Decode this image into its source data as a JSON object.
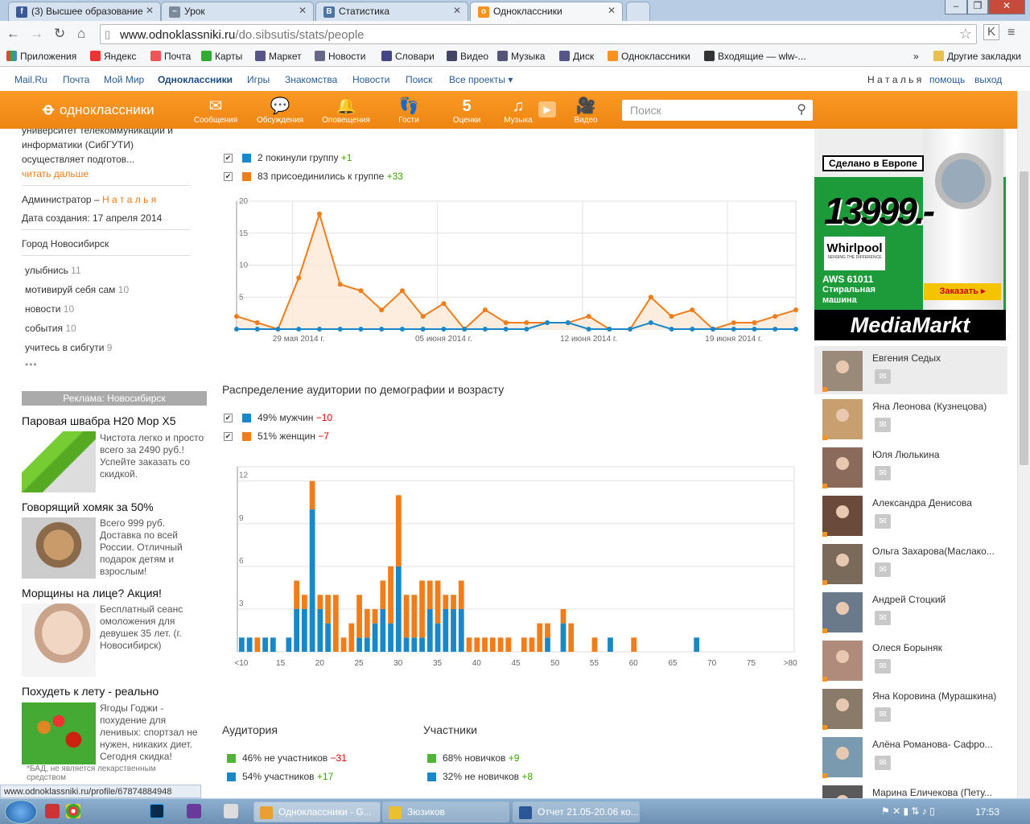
{
  "browser": {
    "tabs": [
      {
        "title": "(3) Высшее образование",
        "icon": "facebook-icon",
        "color": "#3b5998",
        "glyph": "f"
      },
      {
        "title": "Урок",
        "icon": "page-icon",
        "color": "#7a8a9a",
        "glyph": "~"
      },
      {
        "title": "Статистика",
        "icon": "vk-icon",
        "color": "#4c75a3",
        "glyph": "B"
      },
      {
        "title": "Одноклассники",
        "icon": "odnoklassniki-icon",
        "color": "#f7931e",
        "glyph": "o"
      }
    ],
    "url_host": "www.odnoklassniki.ru",
    "url_path": "/do.sibsutis/stats/people",
    "bookmarks": [
      {
        "label": "Приложения",
        "color": "#d44"
      },
      {
        "label": "Яндекс",
        "color": "#e33"
      },
      {
        "label": "Почта",
        "color": "#e55"
      },
      {
        "label": "Карты",
        "color": "#3a3"
      },
      {
        "label": "Маркет",
        "color": "#558"
      },
      {
        "label": "Новости",
        "color": "#668"
      },
      {
        "label": "Словари",
        "color": "#448"
      },
      {
        "label": "Видео",
        "color": "#446"
      },
      {
        "label": "Музыка",
        "color": "#557"
      },
      {
        "label": "Диск",
        "color": "#558"
      },
      {
        "label": "Одноклассники",
        "color": "#f7931e"
      },
      {
        "label": "Входящие — wlw-...",
        "color": "#333"
      }
    ],
    "more": "»",
    "other_bookmarks": "Другие закладки",
    "status_url": "www.odnoklassniki.ru/profile/67874884948"
  },
  "portal": {
    "links": [
      "Mail.Ru",
      "Почта",
      "Мой Мир",
      "Одноклассники",
      "Игры",
      "Знакомства",
      "Новости",
      "Поиск",
      "Все проекты ▾"
    ],
    "user": "Н а т а л ь я",
    "help": "помощь",
    "logout": "выход"
  },
  "ok": {
    "logo": "одноклассники",
    "nav": [
      {
        "label": "Сообщения",
        "icon": "envelope-icon",
        "glyph": "✉"
      },
      {
        "label": "Обсуждения",
        "icon": "chat-icon",
        "glyph": "💬"
      },
      {
        "label": "Оповещения",
        "icon": "bell-icon",
        "glyph": "🔔"
      },
      {
        "label": "Гости",
        "icon": "footprints-icon",
        "glyph": "👣"
      },
      {
        "label": "Оценки",
        "icon": "rating-icon",
        "glyph": "5"
      },
      {
        "label": "Музыка",
        "icon": "music-icon",
        "glyph": "♫"
      },
      {
        "label": "Видео",
        "icon": "camera-icon",
        "glyph": "🎥"
      }
    ],
    "search_placeholder": "Поиск"
  },
  "group": {
    "desc1": "университет телекоммуникаций и",
    "desc2": "информатики (СибГУТИ)",
    "desc3": "осуществляет подготов...",
    "read_more": "читать дальше",
    "admin_label": "Администратор –",
    "admin_name": "Н а т а л ь я",
    "created": "Дата создания: 17 апреля 2014",
    "city": "Город Новосибирск",
    "topics": [
      {
        "name": "улыбнись",
        "count": "11"
      },
      {
        "name": "мотивируй себя сам",
        "count": "10"
      },
      {
        "name": "новости",
        "count": "10"
      },
      {
        "name": "события",
        "count": "10"
      },
      {
        "name": "учитесь в сибгути",
        "count": "9"
      }
    ],
    "more": "•••"
  },
  "ads": {
    "header": "Реклама: Новосибирск",
    "items": [
      {
        "title": "Паровая швабра H20 Mop X5",
        "text": "Чистота легко и просто всего за 2490 руб.! Успейте заказать со скидкой."
      },
      {
        "title": "Говорящий хомяк за 50%",
        "text": "Всего 999 руб. Доставка по всей России. Отличный подарок детям и взрослым!"
      },
      {
        "title": "Морщины на лице? Акция!",
        "text": "Бесплатный сеанс омоложения для девушек 35 лет. (г. Новосибирск)"
      },
      {
        "title": "Похудеть к лету - реально",
        "text": "Ягоды Годжи - похудение для ленивых: спортзал не нужен, никаких диет. Сегодня скидка!"
      }
    ],
    "disclaimer": "*БАД, не является лекарственным средством"
  },
  "stats": {
    "left_legend": [
      {
        "text": "2 покинули группу",
        "delta": "+1",
        "color": "#1a88c8"
      },
      {
        "text": "83 присоединились к группе",
        "delta": "+33",
        "color": "#f07c1a"
      }
    ],
    "demo_title": "Распределение аудитории по демографии и возрасту",
    "demo_legend": [
      {
        "text": "49% мужчин",
        "delta": "−10",
        "color": "#1a88c8"
      },
      {
        "text": "51% женщин",
        "delta": "−7",
        "color": "#f07c1a"
      }
    ],
    "audience_title": "Аудитория",
    "audience": [
      {
        "text": "46% не участников",
        "delta": "−31",
        "color": "#4fb535"
      },
      {
        "text": "54% участников",
        "delta": "+17",
        "color": "#1a88c8"
      }
    ],
    "members_title": "Участники",
    "members": [
      {
        "text": "68% новичков",
        "delta": "+9",
        "color": "#4fb535"
      },
      {
        "text": "32% не новичков",
        "delta": "+8",
        "color": "#1a88c8"
      }
    ]
  },
  "chart_data": [
    {
      "type": "line",
      "x_tick_labels": [
        "29 мая 2014 г.",
        "05 июня 2014 г.",
        "12 июня 2014 г.",
        "19 июня 2014 г."
      ],
      "ylim": [
        0,
        20
      ],
      "yticks": [
        5,
        10,
        15,
        20
      ],
      "series": [
        {
          "name": "присоединились к группе",
          "color": "#f07c1a",
          "values": [
            2,
            1,
            0,
            8,
            18,
            7,
            6,
            3,
            6,
            2,
            4,
            0,
            3,
            1,
            1,
            1,
            1,
            2,
            0,
            0,
            5,
            2,
            3,
            0,
            1,
            1,
            2,
            3
          ]
        },
        {
          "name": "покинули группу",
          "color": "#1a88c8",
          "values": [
            0,
            0,
            0,
            0,
            0,
            0,
            0,
            0,
            0,
            0,
            0,
            0,
            0,
            0,
            0,
            1,
            1,
            0,
            0,
            0,
            1,
            0,
            0,
            0,
            0,
            0,
            0,
            0
          ]
        }
      ]
    },
    {
      "type": "bar",
      "x_tick_labels": [
        "<10",
        "15",
        "20",
        "25",
        "30",
        "35",
        "40",
        "45",
        "50",
        "55",
        "60",
        "65",
        "70",
        "75",
        ">80"
      ],
      "ylim": [
        0,
        13
      ],
      "yticks": [
        3,
        6,
        9,
        12
      ],
      "categories": [
        "<10",
        "11",
        "12",
        "13",
        "14",
        "15",
        "16",
        "17",
        "18",
        "19",
        "20",
        "21",
        "22",
        "23",
        "24",
        "25",
        "26",
        "27",
        "28",
        "29",
        "30",
        "31",
        "32",
        "33",
        "34",
        "35",
        "36",
        "37",
        "38",
        "39",
        "40",
        "41",
        "42",
        "43",
        "44",
        "45",
        "46",
        "47",
        "48",
        "49",
        "50",
        "51",
        "52",
        "53",
        "54",
        "55",
        "56",
        "57",
        "58",
        "59",
        "60",
        "61",
        "62",
        "63",
        "64",
        "65",
        "66",
        "67",
        "68",
        "69",
        "70",
        "71",
        "72",
        "73",
        "74",
        "75",
        "76",
        "77",
        "78",
        "79",
        ">80"
      ],
      "series": [
        {
          "name": "мужчины",
          "color": "#1a88c8",
          "values": [
            1,
            1,
            0,
            1,
            1,
            0,
            1,
            3,
            3,
            10,
            3,
            2,
            0,
            0,
            0,
            1,
            1,
            2,
            3,
            2,
            6,
            1,
            1,
            1,
            3,
            2,
            3,
            3,
            3,
            0,
            0,
            0,
            0,
            0,
            0,
            0,
            0,
            0,
            0,
            1,
            0,
            2,
            0,
            0,
            0,
            0,
            0,
            1,
            0,
            0,
            0,
            0,
            0,
            0,
            0,
            0,
            0,
            0,
            1,
            0,
            0,
            0,
            0,
            0,
            0,
            0,
            0,
            0,
            0,
            0,
            0
          ]
        },
        {
          "name": "женщины",
          "color": "#f07c1a",
          "values": [
            0,
            0,
            1,
            0,
            0,
            0,
            0,
            2,
            1,
            2,
            1,
            2,
            4,
            1,
            2,
            3,
            2,
            1,
            2,
            4,
            5,
            3,
            3,
            4,
            2,
            3,
            1,
            1,
            2,
            1,
            1,
            1,
            1,
            1,
            1,
            0,
            1,
            1,
            2,
            1,
            0,
            1,
            2,
            0,
            0,
            1,
            0,
            0,
            0,
            0,
            1,
            0,
            0,
            0,
            0,
            0,
            0,
            0,
            0,
            0,
            0,
            0,
            0,
            0,
            0,
            0,
            0,
            0,
            0,
            0,
            0
          ]
        }
      ]
    }
  ],
  "banner": {
    "tag": "Сделано в Европе",
    "price": "13999.-",
    "brand": "Whirlpool",
    "brand_sub": "SENSING THE DIFFERENCE",
    "model": "AWS 61011",
    "desc1": "Стиральная",
    "desc2": "машина",
    "order": "Заказать ▸",
    "store": "MediaMarkt"
  },
  "friends": [
    "Евгения Седых",
    "Яна Леонова (Кузнецова)",
    "Юля Люлькина",
    "Александра Денисова",
    "Ольга Захарова(Маслако...",
    "Андрей Стоцкий",
    "Олеся Борыняк",
    "Яна Коровина (Мурашкина)",
    "Алёна Романова- Сафро...",
    "Марина Еличекова (Пету..."
  ],
  "taskbar": {
    "apps": [
      {
        "label": "Одноклассники - G...",
        "color": "#e8a030"
      },
      {
        "label": "Зюзиков",
        "color": "#e8c030"
      },
      {
        "label": "Отчет 21.05-20.06 ко...",
        "color": "#2b5797"
      }
    ],
    "clock": "17:53"
  }
}
